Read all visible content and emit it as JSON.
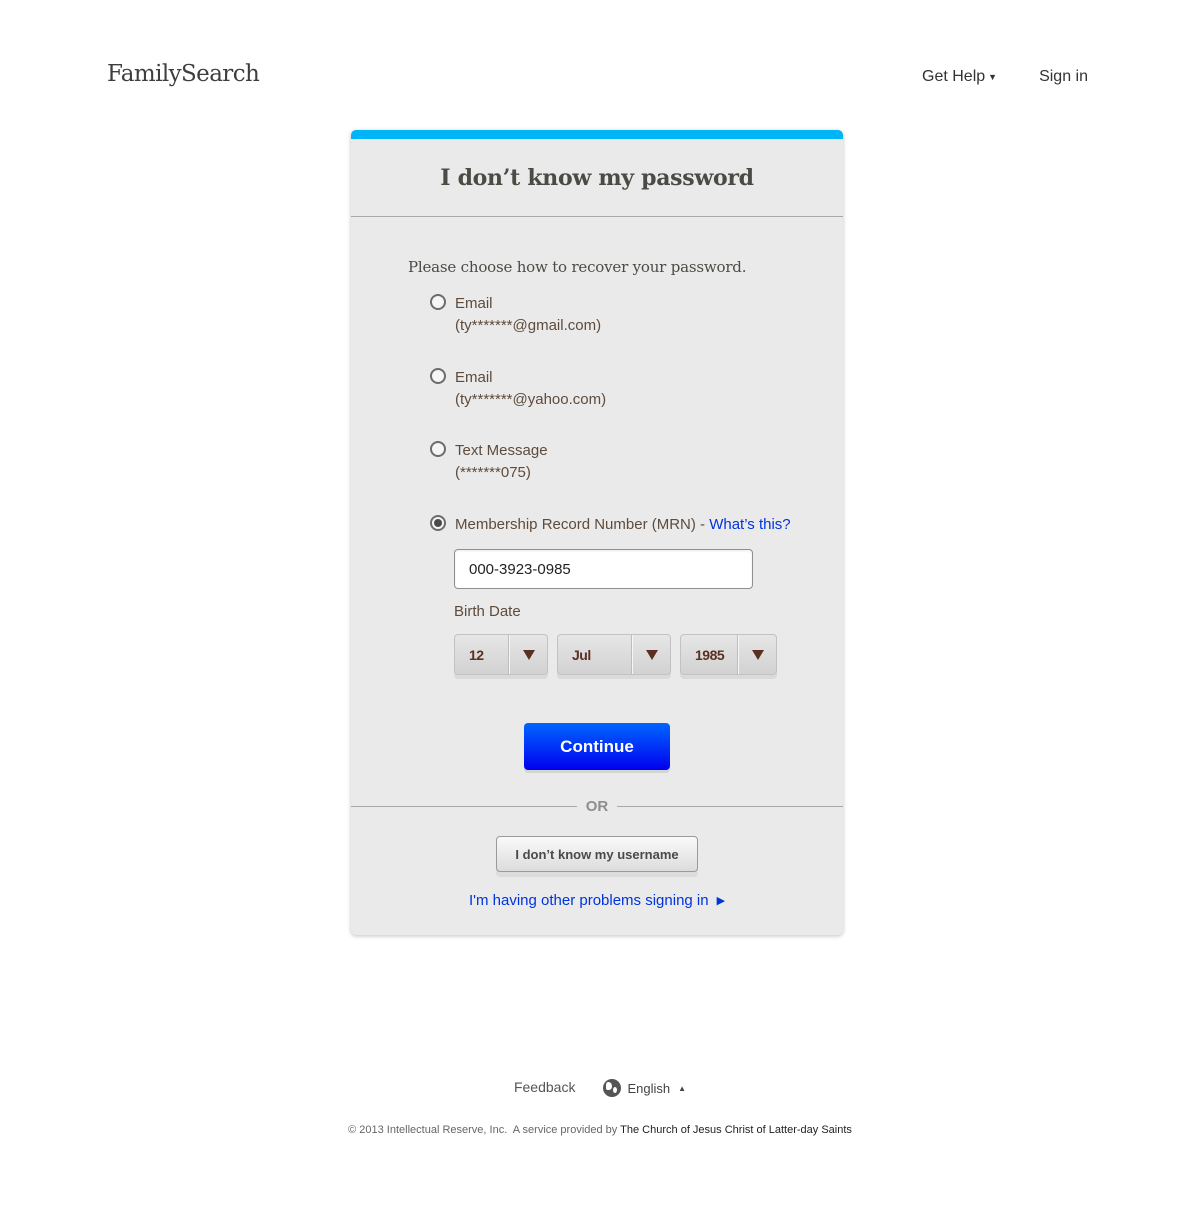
{
  "header": {
    "logo": "FamilySearch",
    "nav": {
      "get_help": "Get Help",
      "get_help_caret": "▼",
      "sign_in": "Sign in"
    }
  },
  "card": {
    "accent_color": "#00b5f5",
    "title": "I don’t know my password",
    "prompt": "Please choose how to recover your password.",
    "options": [
      {
        "label": "Email",
        "detail": "(ty*******@gmail.com)",
        "checked": false
      },
      {
        "label": "Email",
        "detail": "(ty*******@yahoo.com)",
        "checked": false
      },
      {
        "label": "Text Message",
        "detail": "(*******075)",
        "checked": false
      },
      {
        "label": "Membership Record Number (MRN) - ",
        "link": "What’s this?",
        "checked": true
      }
    ],
    "mrn_value": "000-3923-0985",
    "birth_date_label": "Birth Date",
    "birth_date": {
      "day": "12",
      "month": "Jul",
      "year": "1985"
    },
    "continue_label": "Continue",
    "or_label": "OR",
    "username_button": "I don’t know my username",
    "problems_link": "I'm having other problems signing in",
    "problems_arrow": "▶"
  },
  "footer": {
    "feedback": "Feedback",
    "language": "English",
    "language_caret": "▲",
    "copyright": "© 2013 Intellectual Reserve, Inc.  A service provided by ",
    "church_link": "The Church of Jesus Christ of Latter-day Saints"
  }
}
